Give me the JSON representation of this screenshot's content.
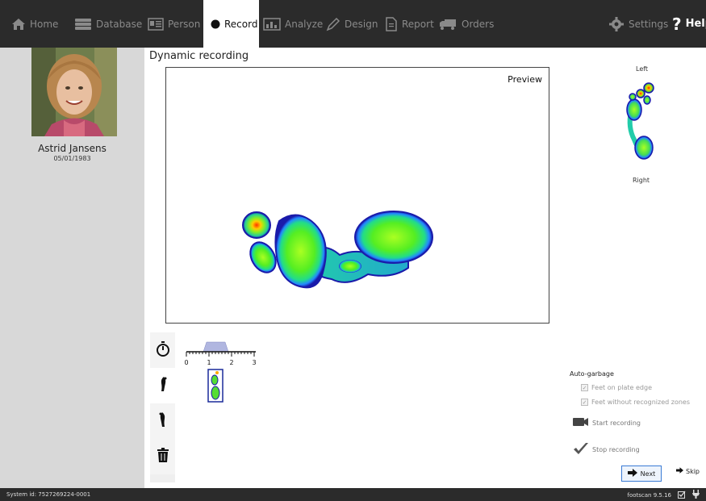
{
  "nav": {
    "home": "Home",
    "database": "Database",
    "person": "Person",
    "record": "Record",
    "analyze": "Analyze",
    "design": "Design",
    "report": "Report",
    "orders": "Orders",
    "settings": "Settings",
    "help": "Help"
  },
  "person": {
    "name": "Astrid Jansens",
    "dob": "05/01/1983"
  },
  "main": {
    "title": "Dynamic recording",
    "preview_label": "Preview"
  },
  "footprint_panel": {
    "left_label": "Left",
    "right_label": "Right"
  },
  "timeline": {
    "ticks": [
      "0",
      "1",
      "2",
      "3"
    ]
  },
  "auto_garbage": {
    "title": "Auto-garbage",
    "options": [
      {
        "label": "Feet on plate edge",
        "checked": true
      },
      {
        "label": "Feet without recognized zones",
        "checked": true
      }
    ]
  },
  "recording": {
    "start": "Start recording",
    "stop": "Stop recording"
  },
  "buttons": {
    "next": "Next",
    "skip": "Skip"
  },
  "status": {
    "system_id": "System id: 7527269224-0001",
    "version": "footscan 9.5.16"
  },
  "colors": {
    "topbar": "#2b2b2b",
    "sidebar": "#d8d8d8",
    "accent": "#3a7bd5"
  }
}
